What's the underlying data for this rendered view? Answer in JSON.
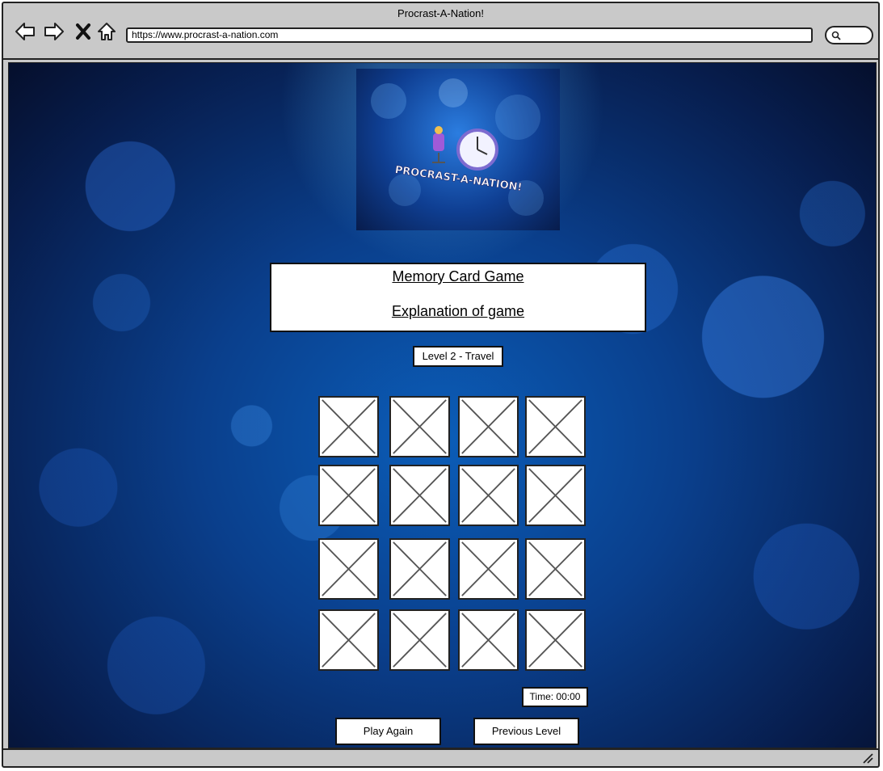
{
  "browser": {
    "title": "Procrast-A-Nation!",
    "url": "https://www.procrast-a-nation.com",
    "icons": [
      "back-arrow-icon",
      "forward-arrow-icon",
      "close-icon",
      "home-icon",
      "search-icon"
    ]
  },
  "logo": {
    "text": "PROCRAST-A-NATION!"
  },
  "info": {
    "title": "Memory Card Game",
    "subtitle": "Explanation of game"
  },
  "level": {
    "label": "Level 2 - Travel"
  },
  "cards": {
    "rows": 4,
    "columns": 4,
    "state": "face-down placeholder"
  },
  "timer": {
    "label": "Time: 00:00"
  },
  "buttons": {
    "play_again": "Play Again",
    "previous_level": "Previous Level"
  },
  "colors": {
    "background_blue": "#0a3f8c",
    "frame": "#c9c9c9"
  }
}
